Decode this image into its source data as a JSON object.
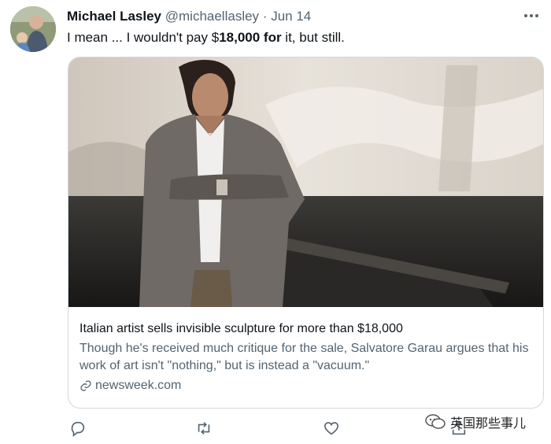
{
  "tweet": {
    "author_name": "Michael Lasley",
    "handle": "@michaellasley",
    "separator": "·",
    "date": "Jun 14",
    "text_before": "I mean ... I wouldn't pay $",
    "text_bold": "18,000 for",
    "text_after": " it, but still."
  },
  "card": {
    "title": "Italian artist sells invisible sculpture for more than $18,000",
    "description": "Though he's received much critique for the sale, Salvatore Garau argues that his work of art isn't \"nothing,\" but is instead a \"vacuum.\"",
    "domain": "newsweek.com"
  },
  "actions": [
    {
      "icon": "reply-icon"
    },
    {
      "icon": "retweet-icon"
    },
    {
      "icon": "like-icon"
    },
    {
      "icon": "share-icon"
    }
  ],
  "watermark": {
    "text": "英国那些事儿"
  },
  "colors": {
    "text_primary": "#0f1419",
    "text_secondary": "#536471",
    "border": "#cfd9de"
  }
}
